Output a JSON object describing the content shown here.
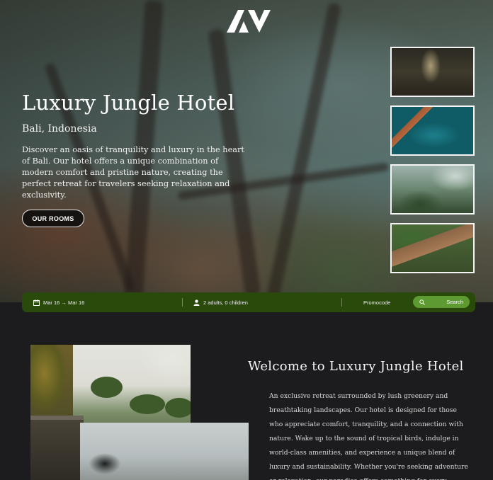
{
  "hero": {
    "title": "Luxury Jungle Hotel",
    "location": "Bali, Indonesia",
    "description": "Discover an oasis of tranquility and luxury in the heart of Bali. Our hotel offers a unique combination of modern comfort and pristine nature, creating the perfect retreat for travelers seeking relaxation and exclusivity.",
    "cta_label": "OUR ROOMS"
  },
  "gallery": {
    "thumbnails": [
      "lounge-room",
      "pool-deck",
      "mountain-villa",
      "terrace-deck"
    ]
  },
  "booking": {
    "date_range": "Mar 16 → Mar 16",
    "guests": "2 adults, 0 children",
    "promocode_label": "Promocode",
    "search_label": "Search"
  },
  "about": {
    "title": "Welcome to Luxury Jungle Hotel",
    "text": "An exclusive retreat surrounded by lush greenery and breathtaking landscapes. Our hotel is designed for those who appreciate comfort, tranquility, and a connection with nature. Wake up to the sound of tropical birds, indulge in world-class amenities, and experience a unique blend of luxury and sustainability. Whether you're seeking adventure or relaxation, our paradise offers something for every traveler."
  },
  "colors": {
    "booking_bar": "#2a4a0c",
    "search_button": "#5d9a31",
    "page_background": "#1c1c1e"
  },
  "icons": {
    "logo": "av-logo-icon",
    "date": "calendar-icon",
    "guests": "person-icon",
    "search": "search-icon"
  }
}
